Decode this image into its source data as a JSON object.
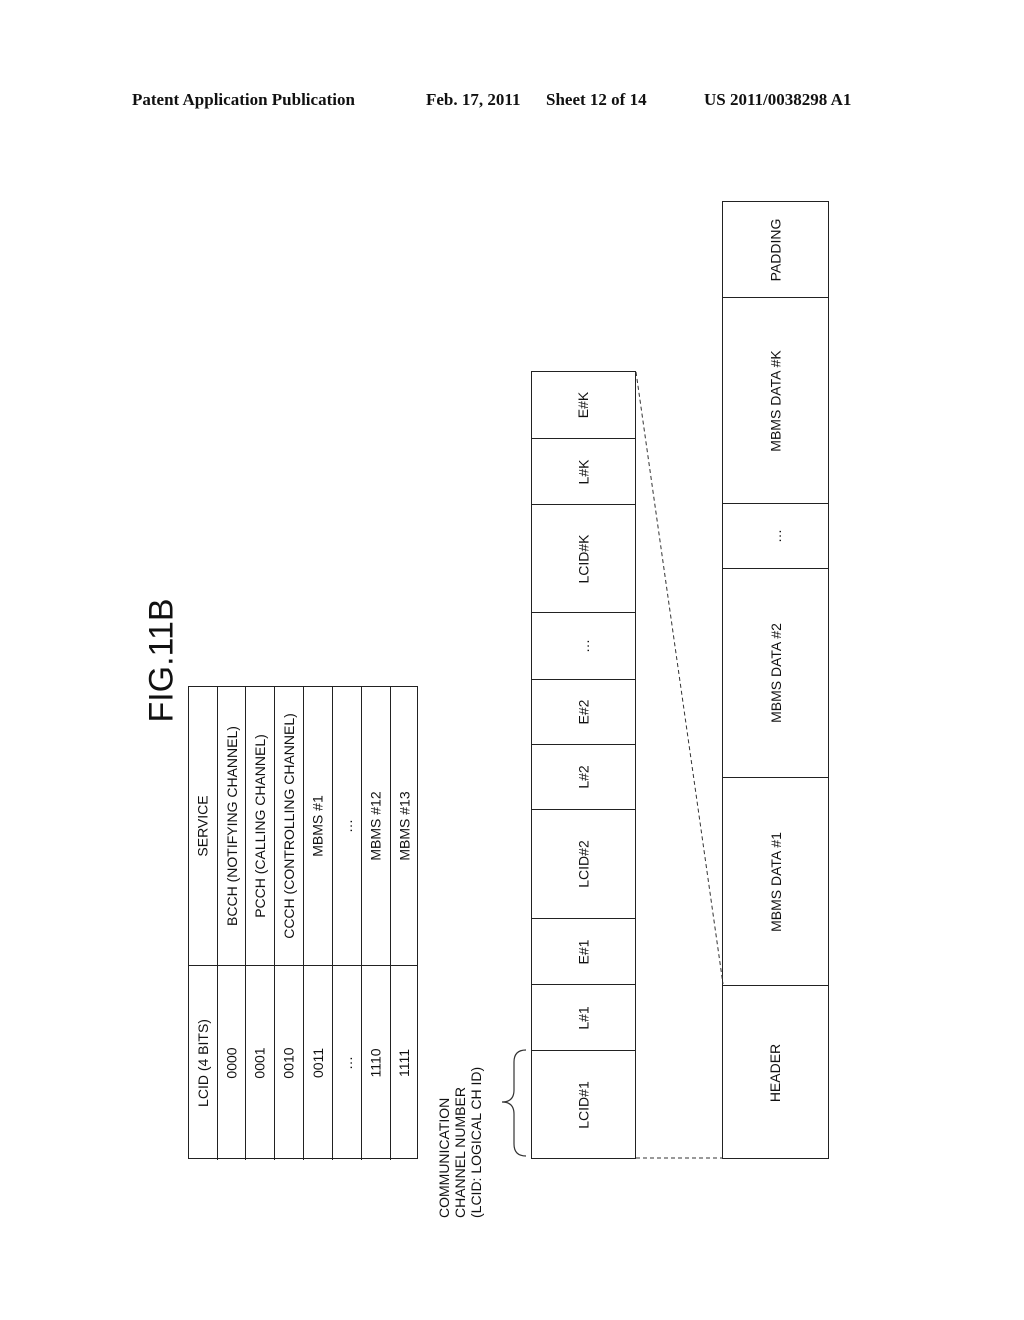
{
  "header": {
    "left": "Patent Application Publication",
    "date": "Feb. 17, 2011",
    "sheet": "Sheet 12 of 14",
    "number": "US 2011/0038298 A1"
  },
  "figure": {
    "label": "FIG.11B"
  },
  "lcid_table": {
    "columns": [
      "LCID (4 BITS)",
      "SERVICE"
    ],
    "rows": [
      [
        "0000",
        "BCCH (NOTIFYING CHANNEL)"
      ],
      [
        "0001",
        "PCCH (CALLING CHANNEL)"
      ],
      [
        "0010",
        "CCCH (CONTROLLING CHANNEL)"
      ],
      [
        "0011",
        "MBMS #1"
      ],
      [
        "…",
        "…"
      ],
      [
        "1110",
        "MBMS #12"
      ],
      [
        "1111",
        "MBMS #13"
      ]
    ]
  },
  "annotation": {
    "lines": [
      "COMMUNICATION",
      "CHANNEL NUMBER",
      "(LCID: LOGICAL CH ID)"
    ]
  },
  "header_fields": [
    "LCID#1",
    "L#1",
    "E#1",
    "LCID#2",
    "L#2",
    "E#2",
    "…",
    "LCID#K",
    "L#K",
    "E#K"
  ],
  "pdu_fields": [
    "HEADER",
    "MBMS DATA #1",
    "MBMS DATA #2",
    "…",
    "MBMS DATA #K",
    "PADDING"
  ]
}
